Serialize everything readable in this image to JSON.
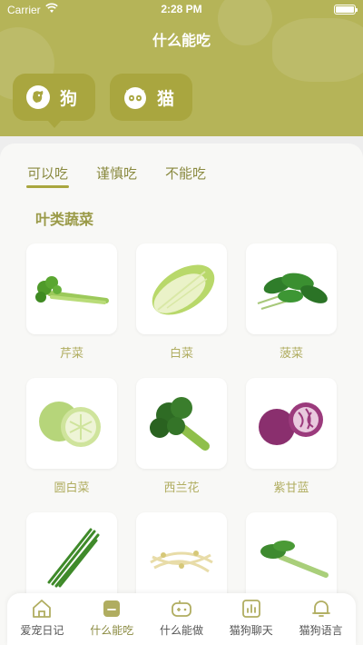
{
  "status_bar": {
    "carrier": "Carrier",
    "time": "2:28 PM"
  },
  "header": {
    "title": "什么能吃"
  },
  "pets": [
    {
      "label": "狗",
      "icon": "dog-icon"
    },
    {
      "label": "猫",
      "icon": "cat-icon"
    }
  ],
  "filter_tabs": [
    {
      "label": "可以吃",
      "active": true
    },
    {
      "label": "谨慎吃",
      "active": false
    },
    {
      "label": "不能吃",
      "active": false
    }
  ],
  "section_title": "叶类蔬菜",
  "foods": [
    {
      "name": "芹菜",
      "icon": "celery-image"
    },
    {
      "name": "白菜",
      "icon": "napa-cabbage-image"
    },
    {
      "name": "菠菜",
      "icon": "spinach-image"
    },
    {
      "name": "圆白菜",
      "icon": "cabbage-image"
    },
    {
      "name": "西兰花",
      "icon": "broccoli-image"
    },
    {
      "name": "紫甘蓝",
      "icon": "red-cabbage-image"
    },
    {
      "name": "",
      "icon": "chives-image"
    },
    {
      "name": "",
      "icon": "bean-sprouts-image"
    },
    {
      "name": "",
      "icon": "choy-sum-image"
    }
  ],
  "tab_bar": [
    {
      "label": "爱宠日记",
      "icon": "house-icon",
      "active": false
    },
    {
      "label": "什么能吃",
      "icon": "bowl-icon",
      "active": true
    },
    {
      "label": "什么能做",
      "icon": "gamepad-icon",
      "active": false
    },
    {
      "label": "猫狗聊天",
      "icon": "chart-icon",
      "active": false
    },
    {
      "label": "猫狗语言",
      "icon": "bell-icon",
      "active": false
    }
  ],
  "colors": {
    "header": "#b5b458",
    "accent": "#a9a63f",
    "label": "#b0ad60",
    "background": "#f8f8f6"
  }
}
